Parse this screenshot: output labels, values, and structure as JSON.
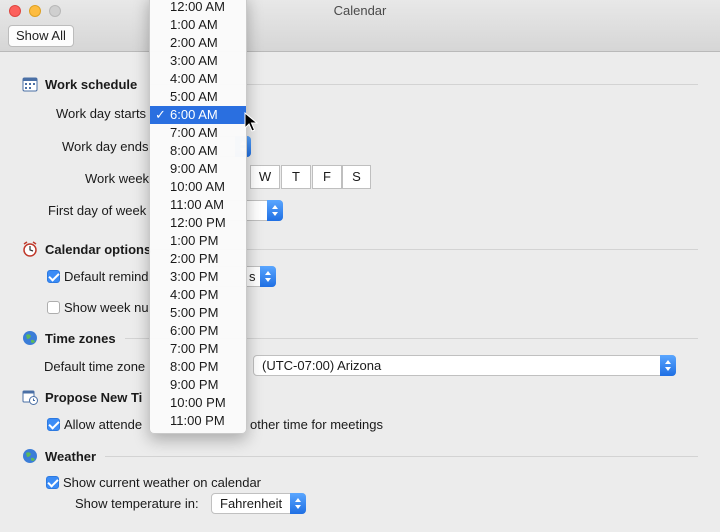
{
  "window": {
    "title": "Calendar",
    "show_all": "Show All"
  },
  "work_schedule": {
    "header": "Work schedule",
    "day_starts_label": "Work day starts",
    "day_ends_label": "Work day ends",
    "week_label": "Work week",
    "first_day_label": "First day of week",
    "visible_days": [
      "W",
      "T",
      "F",
      "S"
    ]
  },
  "calendar_options": {
    "header": "Calendar options",
    "default_reminder_label": "Default remind",
    "default_reminder_checked": true,
    "reminder_value_tail": "s",
    "show_week_label": "Show week nu",
    "show_week_checked": false
  },
  "time_zones": {
    "header": "Time zones",
    "default_label": "Default time zone",
    "value": "(UTC-07:00) Arizona"
  },
  "propose": {
    "header": "Propose New Ti",
    "allow_label_start": "Allow attende",
    "allow_label_end": "other time for meetings",
    "checked": true
  },
  "weather": {
    "header": "Weather",
    "show_label": "Show current weather on calendar",
    "checked": true,
    "temp_label": "Show temperature in:",
    "temp_value": "Fahrenheit"
  },
  "time_menu": {
    "selected_index": 6,
    "check_glyph": "✓",
    "items": [
      "12:00 AM",
      "1:00 AM",
      "2:00 AM",
      "3:00 AM",
      "4:00 AM",
      "5:00 AM",
      "6:00 AM",
      "7:00 AM",
      "8:00 AM",
      "9:00 AM",
      "10:00 AM",
      "11:00 AM",
      "12:00 PM",
      "1:00 PM",
      "2:00 PM",
      "3:00 PM",
      "4:00 PM",
      "5:00 PM",
      "6:00 PM",
      "7:00 PM",
      "8:00 PM",
      "9:00 PM",
      "10:00 PM",
      "11:00 PM"
    ]
  },
  "colors": {
    "accent": "#2a6fe0",
    "checkbox": "#3b8cf6"
  }
}
